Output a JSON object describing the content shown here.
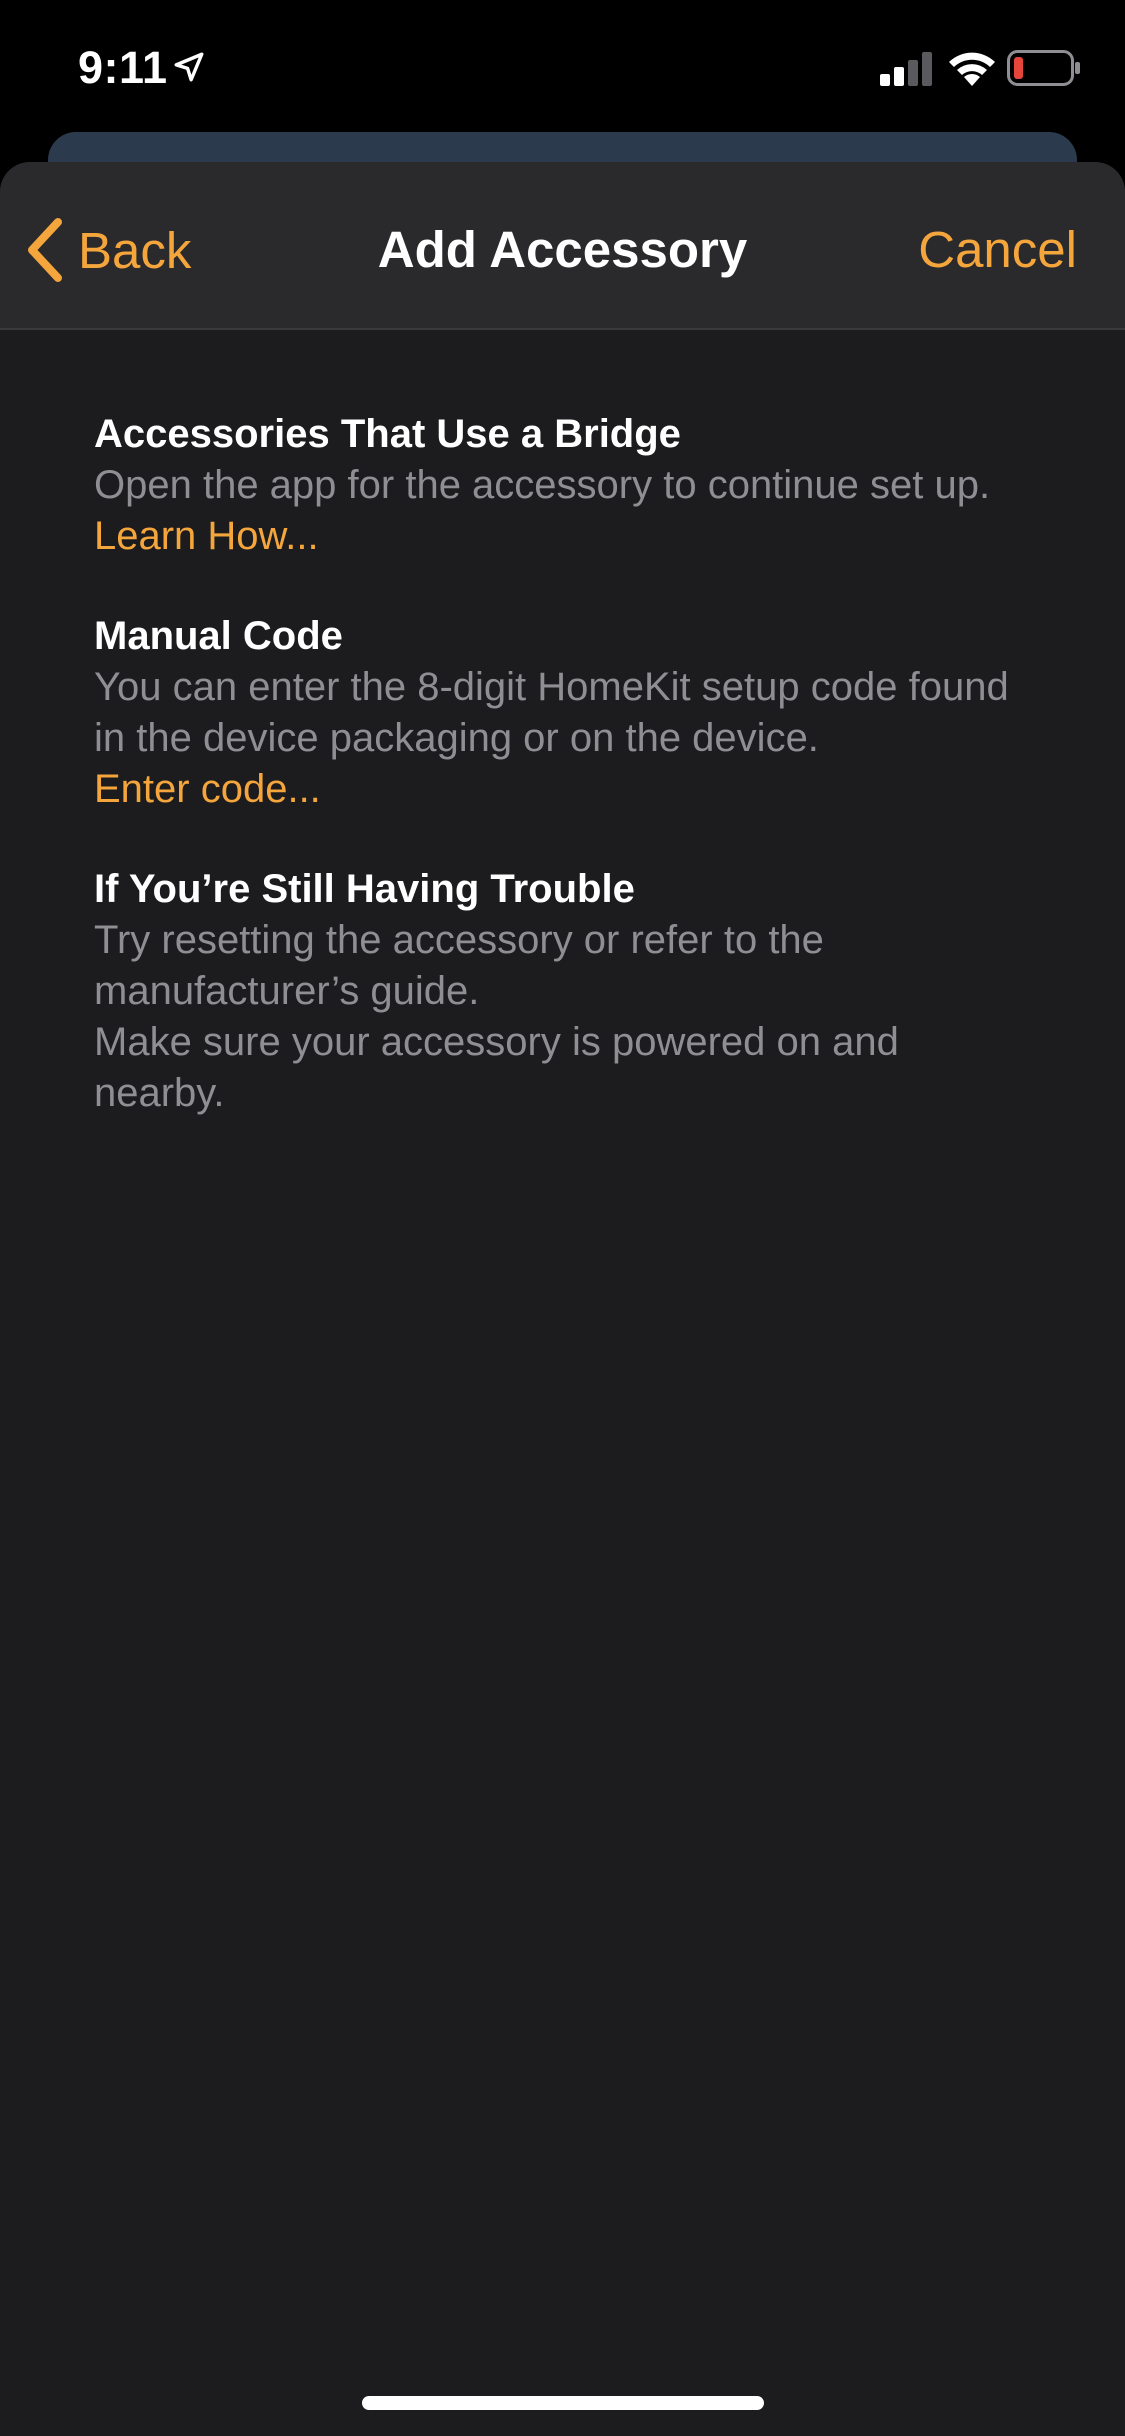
{
  "status_bar": {
    "time": "9:11",
    "battery_color": "#e5453a"
  },
  "nav": {
    "back_label": "Back",
    "title": "Add Accessory",
    "cancel_label": "Cancel"
  },
  "sections": [
    {
      "title": "Accessories That Use a Bridge",
      "body": "Open the app for the accessory to continue set up.",
      "link": "Learn How..."
    },
    {
      "title": "Manual Code",
      "body": "You can enter the 8-digit HomeKit setup code found in the device packaging or on the device.",
      "link": "Enter code..."
    },
    {
      "title": "If You’re Still Having Trouble",
      "body_lines": [
        "Try resetting the accessory or refer to the manufacturer’s guide.",
        "Make sure your accessory is powered on and nearby."
      ]
    }
  ],
  "colors": {
    "accent": "#f4a53c",
    "background": "#1c1c1e",
    "nav_background": "#2a2a2c",
    "secondary_text": "#8e8e93"
  }
}
